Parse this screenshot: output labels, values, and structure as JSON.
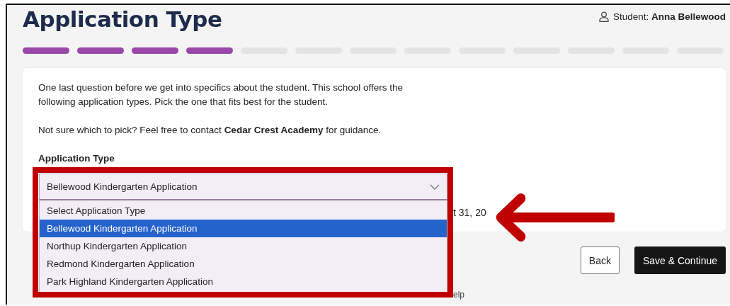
{
  "header": {
    "title": "Application Type",
    "student": "Student: **Anna Bellewood**"
  },
  "progress": {
    "steps": [
      {
        "done": true
      },
      {
        "done": true
      },
      {
        "done": true
      },
      {
        "done": true
      },
      {
        "done": false
      },
      {
        "done": false
      },
      {
        "done": false
      },
      {
        "done": false
      },
      {
        "done": false
      },
      {
        "done": false
      },
      {
        "done": false
      },
      {
        "done": false
      },
      {
        "done": false
      }
    ]
  },
  "card": {
    "intro": "One last question before we get into specifics about the student. This school offers the following application types. Pick the one that fits best for the student.",
    "contact": "Not sure which to pick? Feel free to contact **Cedar Crest Academy** for guidance.",
    "field_label": "Application Type",
    "note_fragment": "t 31, 20",
    "select": {
      "value": "Bellewood Kindergarten Application",
      "expanded": true,
      "options": [
        {
          "label": "Select Application Type",
          "selected": false
        },
        {
          "label": "Bellewood Kindergarten Application",
          "selected": true
        },
        {
          "label": "Northup Kindergarten Application",
          "selected": false
        },
        {
          "label": "Redmond Kindergarten Application",
          "selected": false
        },
        {
          "label": "Park Highland Kindergarten Application",
          "selected": false
        }
      ]
    }
  },
  "actions": {
    "back": "Back",
    "save": "Save & Continue"
  },
  "footer": {
    "link_fragment": "elp"
  }
}
